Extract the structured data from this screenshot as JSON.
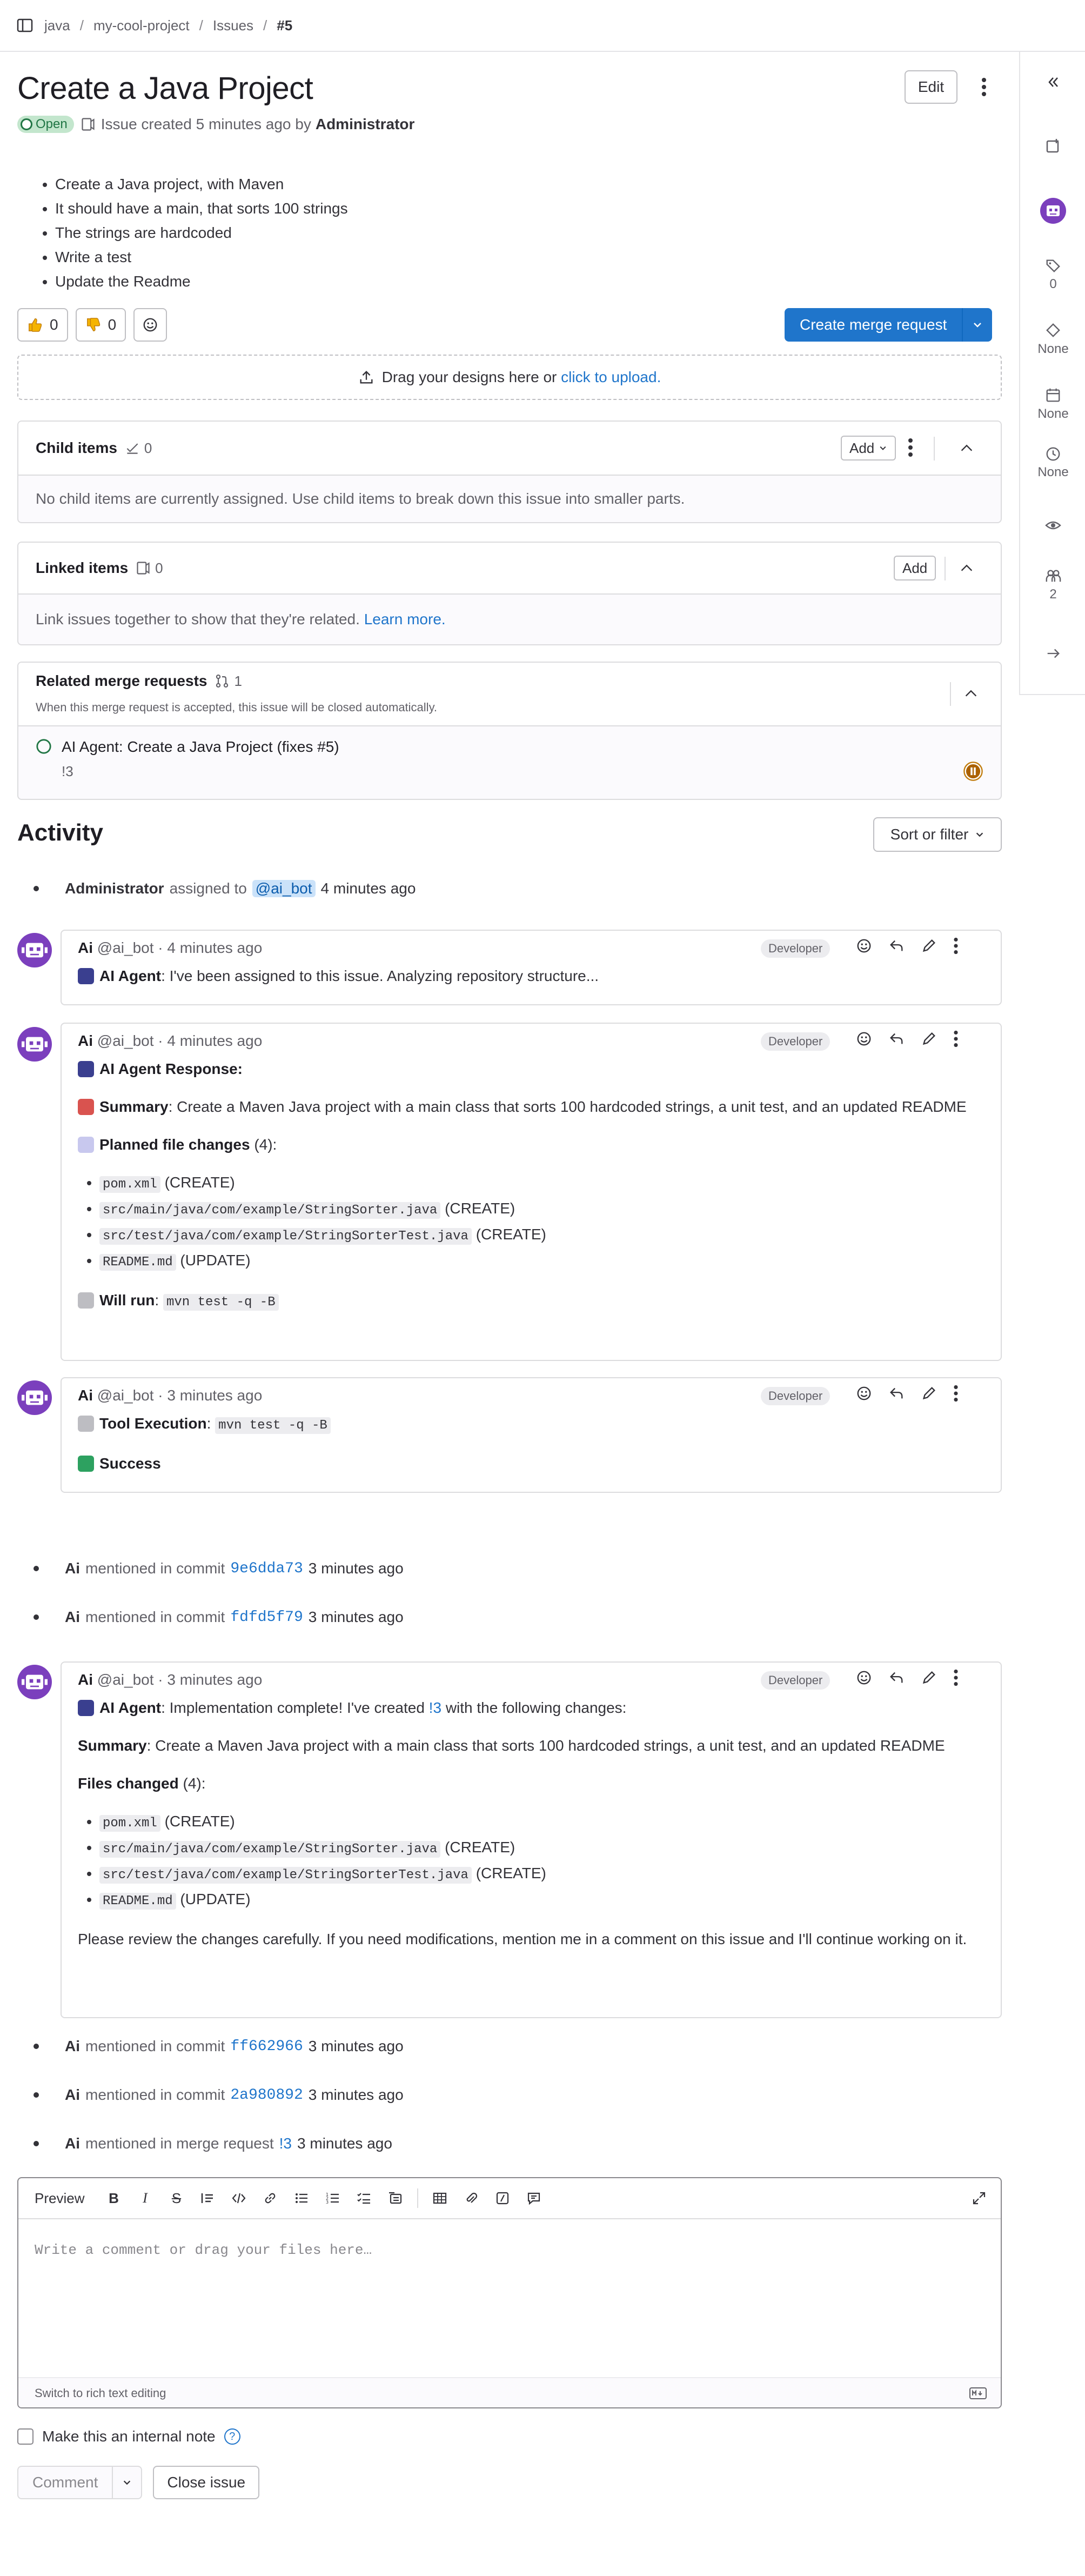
{
  "breadcrumb": [
    "java",
    "my-cool-project",
    "Issues",
    "#5"
  ],
  "issue": {
    "title": "Create a Java Project",
    "edit_label": "Edit",
    "status": "Open",
    "created_text": "Issue created 5 minutes ago by",
    "author": "Administrator",
    "description": [
      "Create a Java project, with Maven",
      "It should have a main, that sorts 100 strings",
      "The strings are hardcoded",
      "Write a test",
      "Update the Readme"
    ],
    "thumbs_up": "0",
    "thumbs_down": "0",
    "create_mr_label": "Create merge request"
  },
  "upload": {
    "text": "Drag your designs here or",
    "link": "click to upload."
  },
  "child_items": {
    "title": "Child items",
    "count": "0",
    "add": "Add",
    "empty": "No child items are currently assigned. Use child items to break down this issue into smaller parts."
  },
  "linked_items": {
    "title": "Linked items",
    "count": "0",
    "add": "Add",
    "empty": "Link issues together to show that they're related.",
    "learn_more": "Learn more."
  },
  "related_mrs": {
    "title": "Related merge requests",
    "count": "1",
    "subtitle": "When this merge request is accepted, this issue will be closed automatically.",
    "mr_title": "AI Agent: Create a Java Project (fixes #5)",
    "mr_ref": "!3"
  },
  "sidebar": {
    "labels_count": "0",
    "milestone": "None",
    "due": "None",
    "time": "None",
    "participants": "2"
  },
  "activity": {
    "heading": "Activity",
    "sort_label": "Sort or filter",
    "assign_note": {
      "actor": "Administrator",
      "text": "assigned to",
      "mention": "@ai_bot",
      "time": "4 minutes ago"
    },
    "commit_notes": [
      {
        "actor": "Ai",
        "text": "mentioned in commit",
        "sha": "9e6dda73",
        "time": "3 minutes ago"
      },
      {
        "actor": "Ai",
        "text": "mentioned in commit",
        "sha": "fdfd5f79",
        "time": "3 minutes ago"
      },
      {
        "actor": "Ai",
        "text": "mentioned in commit",
        "sha": "ff662966",
        "time": "3 minutes ago"
      },
      {
        "actor": "Ai",
        "text": "mentioned in commit",
        "sha": "2a980892",
        "time": "3 minutes ago"
      }
    ],
    "mr_note": {
      "actor": "Ai",
      "text": "mentioned in merge request",
      "ref": "!3",
      "time": "3 minutes ago"
    }
  },
  "notes": {
    "author": "Ai",
    "handle": "@ai_bot",
    "role": "Developer",
    "n1": {
      "time": "· 4 minutes ago",
      "label": "AI Agent",
      "text": ": I've been assigned to this issue. Analyzing repository structure..."
    },
    "n2": {
      "time": "· 4 minutes ago",
      "label": "AI Agent Response:",
      "summary_label": "Summary",
      "summary": ": Create a Maven Java project with a main class that sorts 100 hardcoded strings, a unit test, and an updated README",
      "planned_label": "Planned file changes",
      "planned_count": "(4):",
      "files": [
        {
          "path": "pom.xml",
          "op": "(CREATE)"
        },
        {
          "path": "src/main/java/com/example/StringSorter.java",
          "op": "(CREATE)"
        },
        {
          "path": "src/test/java/com/example/StringSorterTest.java",
          "op": "(CREATE)"
        },
        {
          "path": "README.md",
          "op": "(UPDATE)"
        }
      ],
      "will_run_label": "Will run",
      "will_run_cmd": "mvn test -q -B"
    },
    "n3": {
      "time": "· 3 minutes ago",
      "label": "Tool Execution",
      "cmd": "mvn test -q -B",
      "result": "Success"
    },
    "n4": {
      "time": "· 3 minutes ago",
      "label": "AI Agent",
      "text_a": ": Implementation complete! I've created",
      "mr_ref": "!3",
      "text_b": "with the following changes:",
      "summary_label": "Summary",
      "summary": ": Create a Maven Java project with a main class that sorts 100 hardcoded strings, a unit test, and an updated README",
      "files_label": "Files changed",
      "files_count": "(4):",
      "files": [
        {
          "path": "pom.xml",
          "op": "(CREATE)"
        },
        {
          "path": "src/main/java/com/example/StringSorter.java",
          "op": "(CREATE)"
        },
        {
          "path": "src/test/java/com/example/StringSorterTest.java",
          "op": "(CREATE)"
        },
        {
          "path": "README.md",
          "op": "(UPDATE)"
        }
      ],
      "closing": "Please review the changes carefully. If you need modifications, mention me in a comment on this issue and I'll continue working on it."
    }
  },
  "editor": {
    "preview_tab": "Preview",
    "placeholder": "Write a comment or drag your files here…",
    "switch_label": "Switch to rich text editing",
    "internal_label": "Make this an internal note",
    "comment_label": "Comment",
    "close_label": "Close issue"
  },
  "colors": {
    "accent": "#1f75cb",
    "open_badge": "#c3e6cd",
    "avatar": "#7b3fbd"
  }
}
